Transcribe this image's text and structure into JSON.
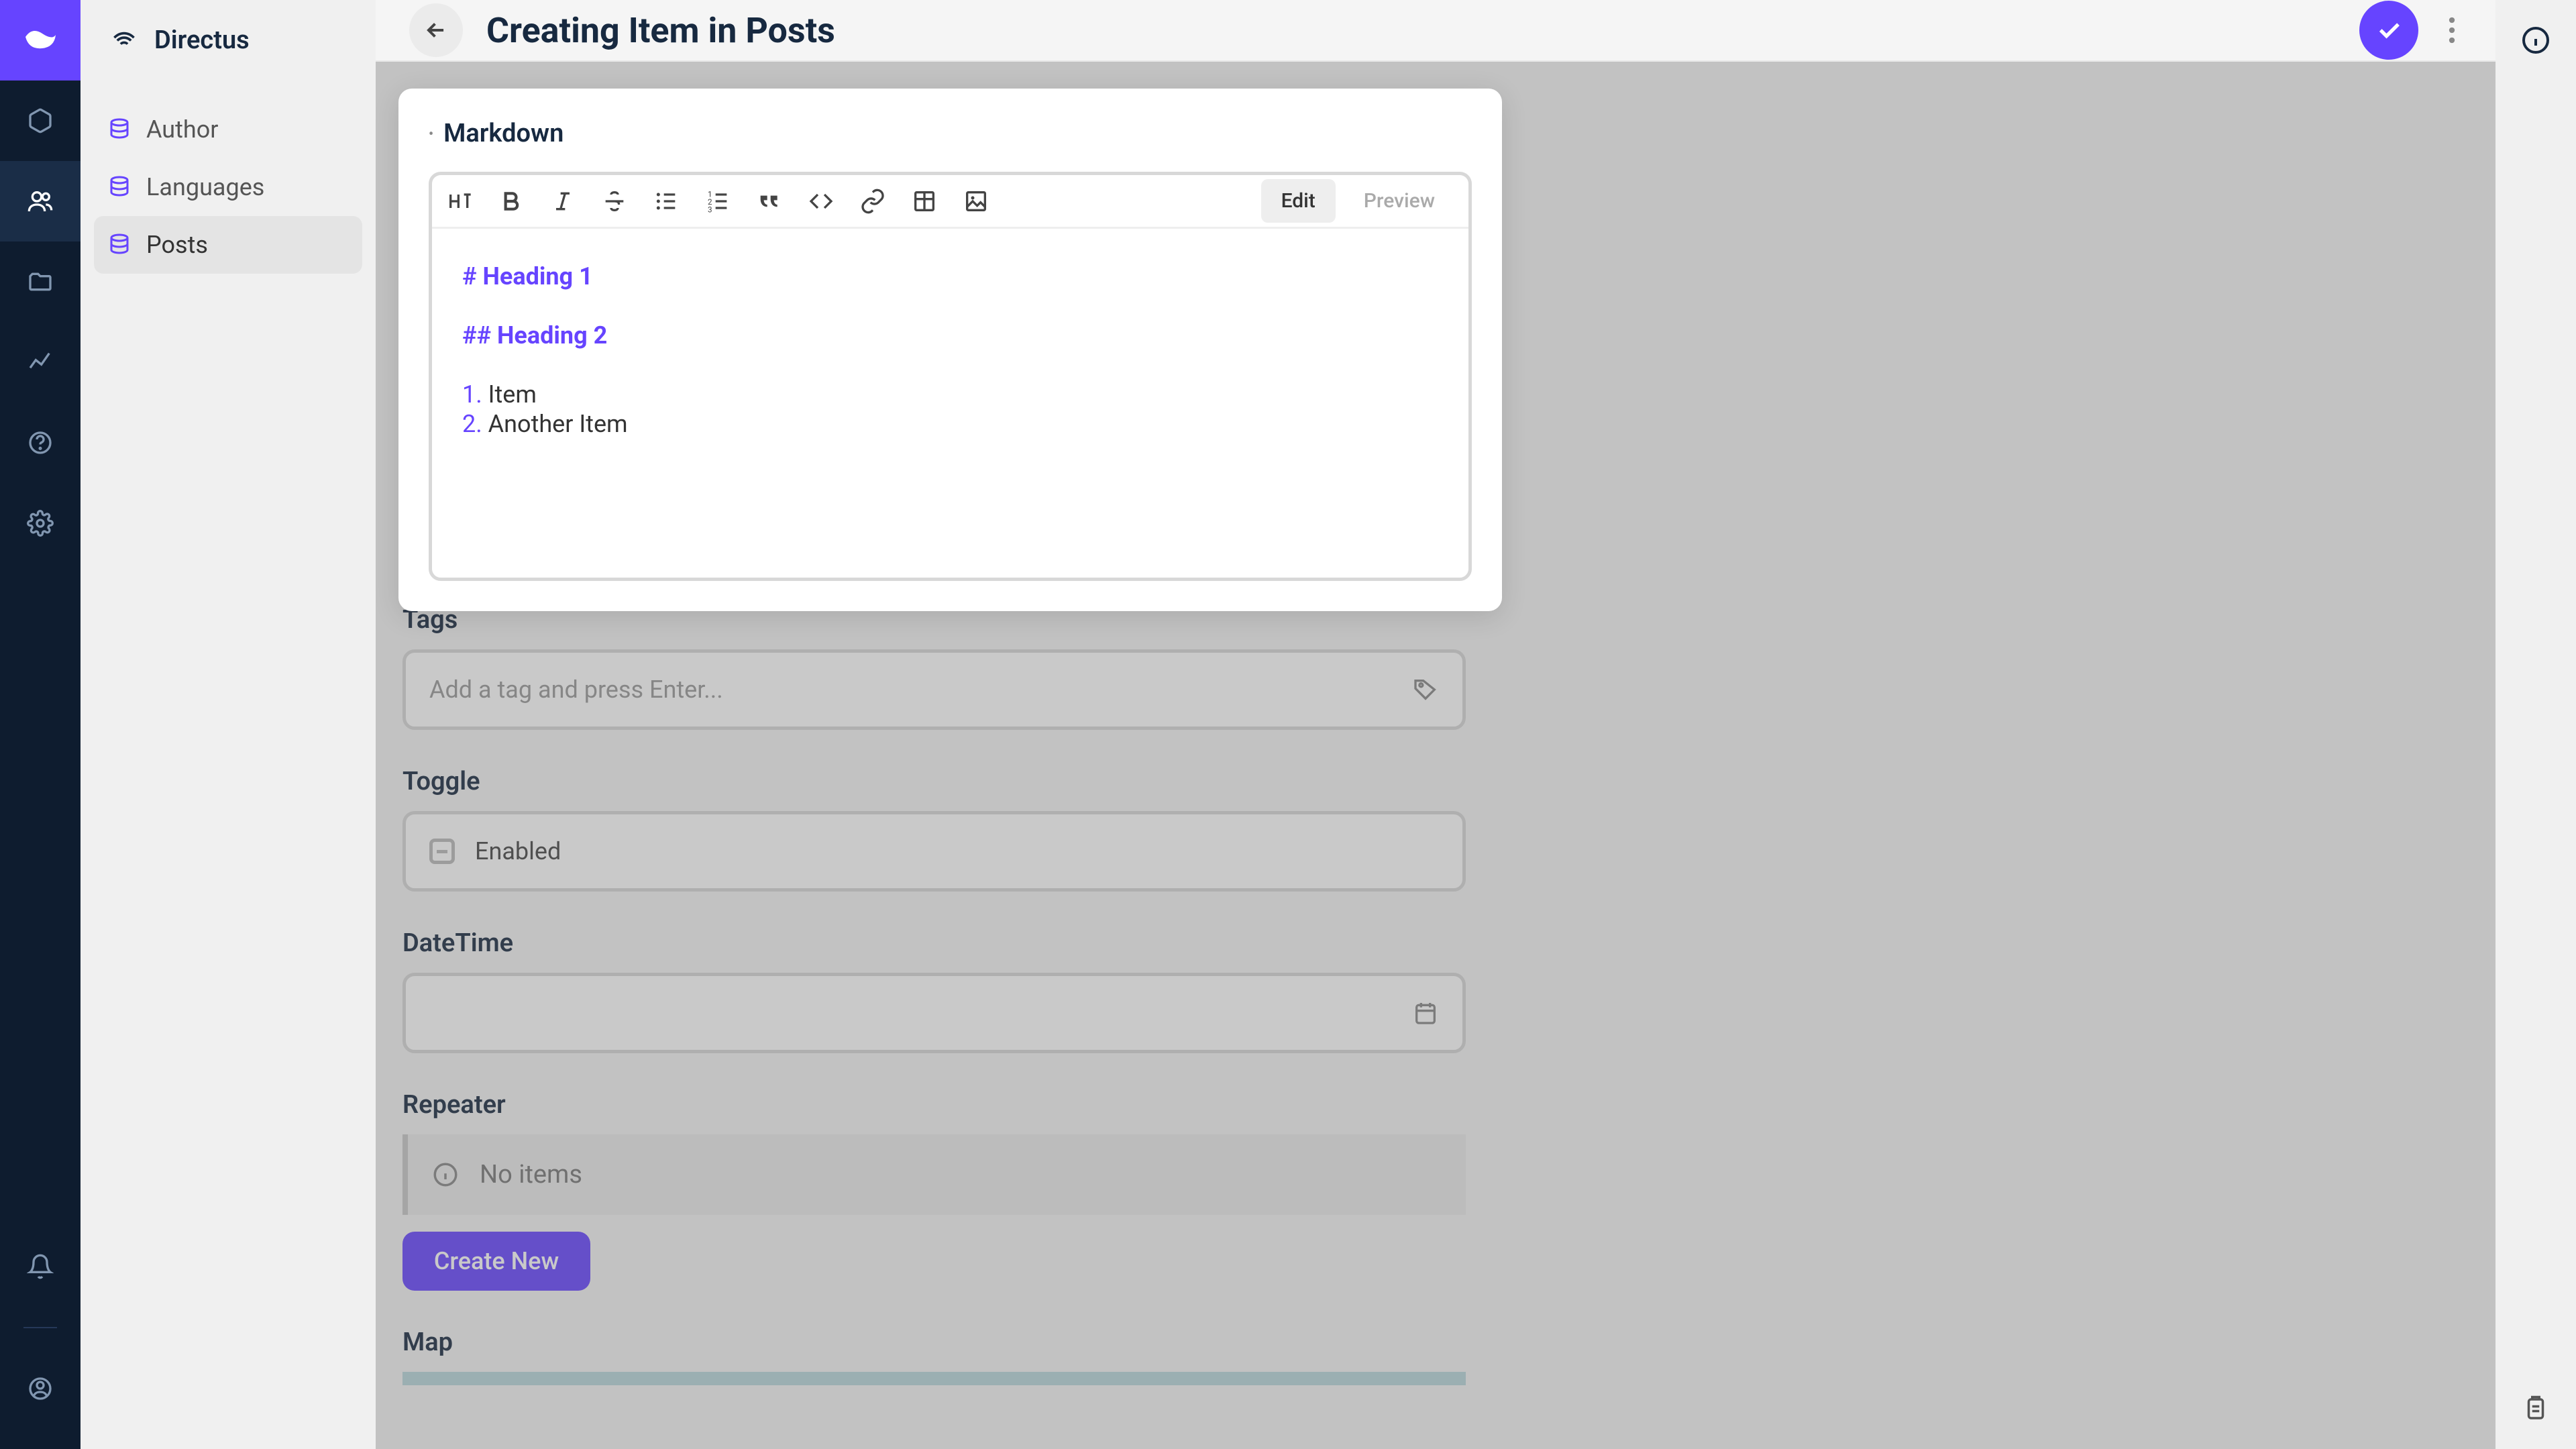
{
  "app": {
    "name": "Directus"
  },
  "sidebar": {
    "items": [
      {
        "label": "Author"
      },
      {
        "label": "Languages"
      },
      {
        "label": "Posts"
      }
    ]
  },
  "header": {
    "title": "Creating Item in Posts"
  },
  "markdown": {
    "label": "Markdown",
    "edit_label": "Edit",
    "preview_label": "Preview",
    "content": {
      "h1_hash": "#",
      "h1_text": "Heading 1",
      "h2_hash": "##",
      "h2_text": "Heading 2",
      "li1_num": "1.",
      "li1_text": "Item",
      "li2_num": "2.",
      "li2_text": "Another Item"
    }
  },
  "fields": {
    "tags": {
      "label": "Tags",
      "placeholder": "Add a tag and press Enter..."
    },
    "toggle": {
      "label": "Toggle",
      "option": "Enabled"
    },
    "datetime": {
      "label": "DateTime"
    },
    "repeater": {
      "label": "Repeater",
      "empty": "No items",
      "create": "Create New"
    },
    "map": {
      "label": "Map"
    }
  },
  "colors": {
    "brand": "#6644ff"
  }
}
